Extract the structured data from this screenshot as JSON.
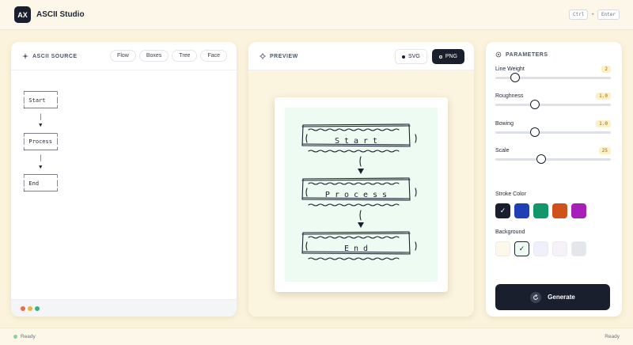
{
  "header": {
    "logo_text": "AX",
    "title": "ASCII Studio",
    "shortcut": {
      "key1": "Ctrl",
      "plus": "+",
      "key2": "Enter"
    }
  },
  "source_panel": {
    "title": "ASCII SOURCE",
    "title_icon": "sparkle-icon",
    "chips": [
      "Flow",
      "Boxes",
      "Tree",
      "Face"
    ],
    "text": "┌─────────┐\n│ Start   │\n└─────────┘\n     │\n     ▼\n┌─────────┐\n│ Process │\n└─────────┘\n     │\n     ▼\n┌─────────┐\n│ End     │\n└─────────┘",
    "footer_dots": [
      "#ef6a4c",
      "#f2b33d",
      "#32b47a"
    ]
  },
  "preview_panel": {
    "title": "PREVIEW",
    "title_icon": "crosshair-icon",
    "formats": [
      {
        "label": "SVG",
        "active": false
      },
      {
        "label": "PNG",
        "active": true
      }
    ],
    "sketch_labels": [
      "Start",
      "Process",
      "End"
    ]
  },
  "params_panel": {
    "title": "PARAMETERS",
    "title_icon": "gear-icon",
    "sliders": [
      {
        "label": "Line Weight",
        "value": "2",
        "fraction": 0.17
      },
      {
        "label": "Roughness",
        "value": "1.0",
        "fraction": 0.34
      },
      {
        "label": "Bowing",
        "value": "1.0",
        "fraction": 0.34
      },
      {
        "label": "Scale",
        "value": "25",
        "fraction": 0.4
      }
    ],
    "stroke_label": "Stroke Color",
    "stroke_colors": [
      "#1a1f2e",
      "#1f3fb5",
      "#12976a",
      "#d1511a",
      "#a71fb8"
    ],
    "stroke_selected": 0,
    "background_label": "Background",
    "background_colors": [
      "#fdf8e8",
      "#eefbf2",
      "#eef1fb",
      "#f7f1fa",
      "#e3e6ea"
    ],
    "background_selected": 1,
    "check_mark": "✓",
    "generate_label": "Generate",
    "generate_icon": "refresh-icon"
  },
  "status": {
    "left": "Ready",
    "right": "Ready",
    "dot_color": "#7fd3a4"
  }
}
